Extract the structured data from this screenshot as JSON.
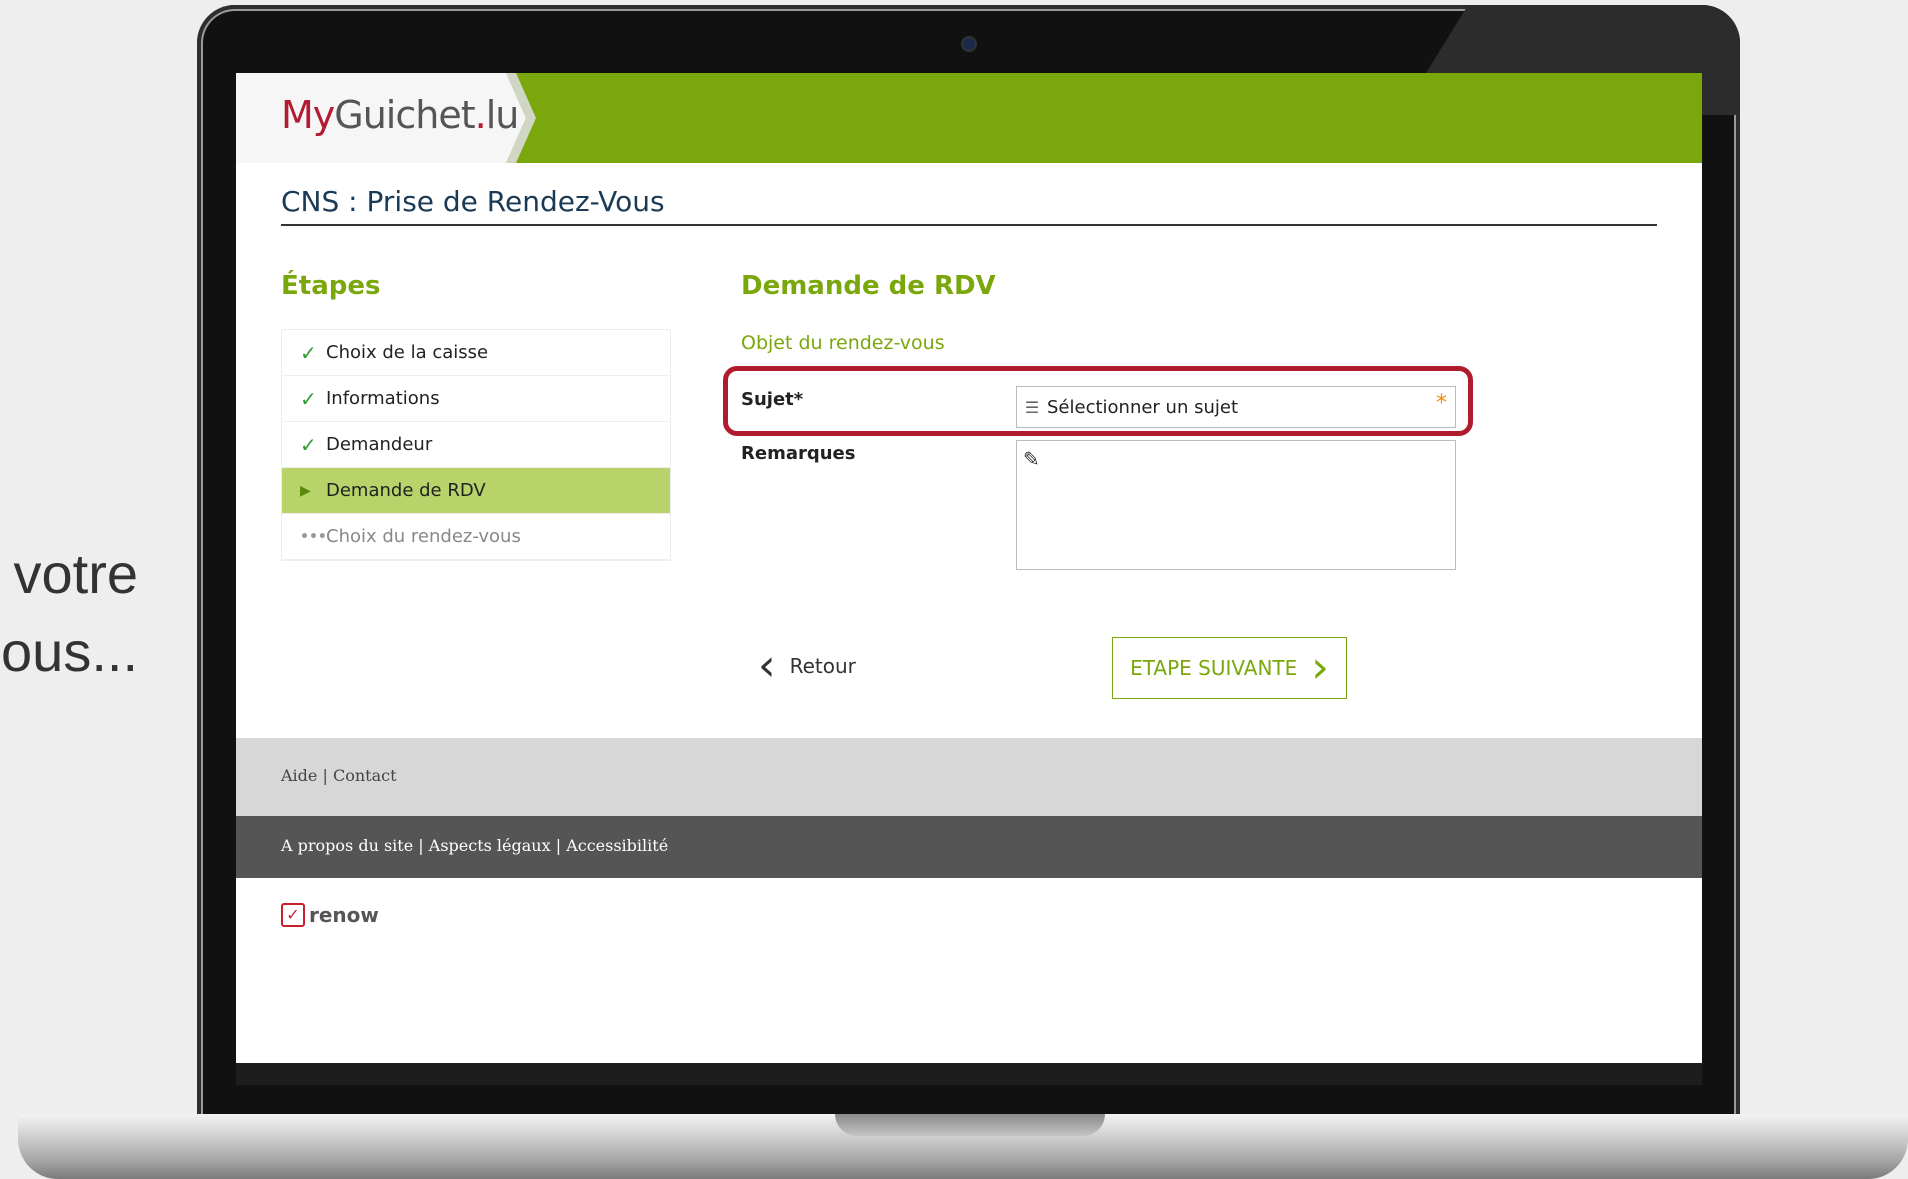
{
  "side_text": [
    "votre",
    "ous..."
  ],
  "logo": {
    "my": "My",
    "guichet": "Guichet",
    "dot": ".",
    "lu": "lu"
  },
  "page_title": "CNS : Prise de Rendez-Vous",
  "steps": {
    "title": "Étapes",
    "items": [
      {
        "label": "Choix de la caisse",
        "marker": "✓",
        "state": "done"
      },
      {
        "label": "Informations",
        "marker": "✓",
        "state": "done"
      },
      {
        "label": "Demandeur",
        "marker": "✓",
        "state": "done"
      },
      {
        "label": "Demande de RDV",
        "marker": "▶",
        "state": "active"
      },
      {
        "label": "Choix du rendez-vous",
        "marker": "•••",
        "state": "future"
      }
    ]
  },
  "form": {
    "title": "Demande de RDV",
    "subtitle": "Objet du rendez-vous",
    "subject_label": "Sujet*",
    "subject_value": "Sélectionner un sujet",
    "required_mark": "*",
    "remarks_label": "Remarques",
    "list_icon": "list-icon",
    "pencil_icon": "pencil-icon"
  },
  "nav": {
    "back_label": "Retour",
    "next_label": "ETAPE SUIVANTE"
  },
  "footer": {
    "aide": "Aide",
    "contact": "Contact",
    "apropos": "A propos du site",
    "legaux": "Aspects légaux",
    "accessibilite": "Accessibilité",
    "renow": "renow"
  },
  "colors": {
    "brand_green": "#7aa70b",
    "highlight_red": "#b01c2e",
    "active_step": "#b7d36a"
  }
}
